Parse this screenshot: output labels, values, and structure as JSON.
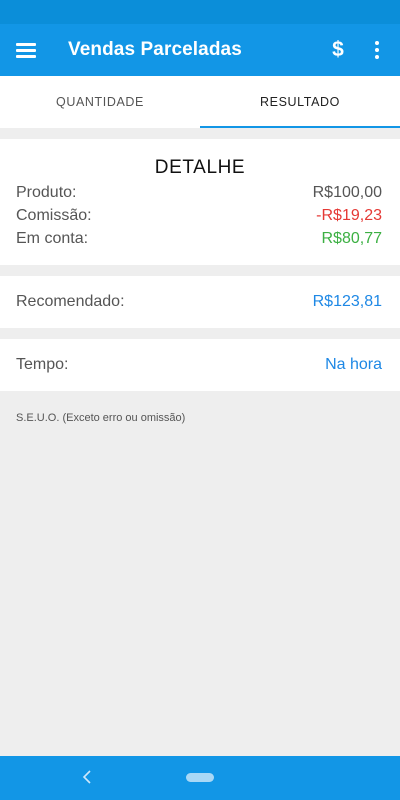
{
  "app_bar": {
    "title": "Vendas Parceladas",
    "menu_icon": "menu-icon",
    "dollar_label": "$",
    "more_icon": "more-vert-icon"
  },
  "tabs": [
    {
      "label": "QUANTIDADE",
      "active": false
    },
    {
      "label": "RESULTADO",
      "active": true
    }
  ],
  "detail": {
    "title": "DETALHE",
    "rows": [
      {
        "label": "Produto:",
        "value": "R$100,00",
        "color": "#555555"
      },
      {
        "label": "Comissão:",
        "value": "-R$19,23",
        "color": "#e53935"
      },
      {
        "label": "Em conta:",
        "value": "R$80,77",
        "color": "#3cb043"
      }
    ]
  },
  "recommended": {
    "label": "Recomendado:",
    "value": "R$123,81",
    "color": "#1e88e5"
  },
  "time": {
    "label": "Tempo:",
    "value": "Na hora",
    "color": "#1e88e5"
  },
  "disclaimer": "S.E.U.O. (Exceto erro ou omissão)",
  "colors": {
    "primary": "#1296e6",
    "status_bar": "#0b8ed9",
    "background": "#eeeeee"
  },
  "nav": {
    "back_icon": "back-chevron-icon",
    "home_icon": "home-pill-icon"
  }
}
